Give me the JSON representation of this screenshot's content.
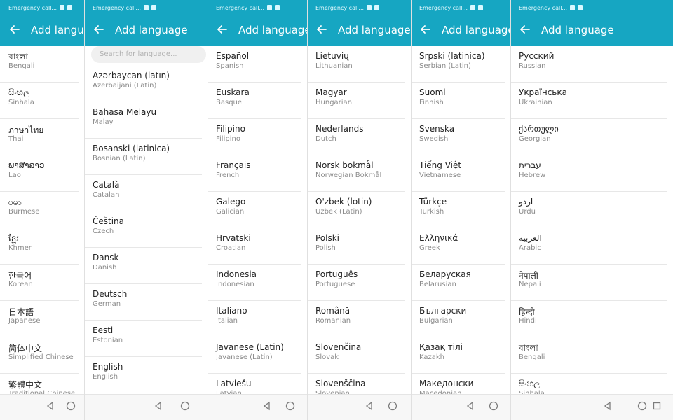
{
  "app_bar": {
    "title": "Add language",
    "status_text": "Emergency call..."
  },
  "search": {
    "placeholder": "Search for language..."
  },
  "panels": [
    {
      "items": [
        {
          "name": "বাংলা",
          "sub": "Bengali"
        },
        {
          "name": "සිංහල",
          "sub": "Sinhala"
        },
        {
          "name": "ภาษาไทย",
          "sub": "Thai"
        },
        {
          "name": "ພາສາລາວ",
          "sub": "Lao"
        },
        {
          "name": "ဗမာ",
          "sub": "Burmese"
        },
        {
          "name": "ខ្មែរ",
          "sub": "Khmer"
        },
        {
          "name": "한국어",
          "sub": "Korean"
        },
        {
          "name": "日本語",
          "sub": "Japanese"
        },
        {
          "name": "简体中文",
          "sub": "Simplified Chinese"
        },
        {
          "name": "繁體中文",
          "sub": "Traditional Chinese"
        }
      ]
    },
    {
      "items": [
        {
          "name": "Azərbaycan (latın)",
          "sub": "Azerbaijani (Latin)"
        },
        {
          "name": "Bahasa Melayu",
          "sub": "Malay"
        },
        {
          "name": "Bosanski (latinica)",
          "sub": "Bosnian (Latin)"
        },
        {
          "name": "Català",
          "sub": "Catalan"
        },
        {
          "name": "Čeština",
          "sub": "Czech"
        },
        {
          "name": "Dansk",
          "sub": "Danish"
        },
        {
          "name": "Deutsch",
          "sub": "German"
        },
        {
          "name": "Eesti",
          "sub": "Estonian"
        },
        {
          "name": "English",
          "sub": "English"
        }
      ]
    },
    {
      "items": [
        {
          "name": "Español",
          "sub": "Spanish"
        },
        {
          "name": "Euskara",
          "sub": "Basque"
        },
        {
          "name": "Filipino",
          "sub": "Filipino"
        },
        {
          "name": "Français",
          "sub": "French"
        },
        {
          "name": "Galego",
          "sub": "Galician"
        },
        {
          "name": "Hrvatski",
          "sub": "Croatian"
        },
        {
          "name": "Indonesia",
          "sub": "Indonesian"
        },
        {
          "name": "Italiano",
          "sub": "Italian"
        },
        {
          "name": "Javanese (Latin)",
          "sub": "Javanese (Latin)"
        },
        {
          "name": "Latviešu",
          "sub": "Latvian"
        }
      ]
    },
    {
      "items": [
        {
          "name": "Lietuvių",
          "sub": "Lithuanian"
        },
        {
          "name": "Magyar",
          "sub": "Hungarian"
        },
        {
          "name": "Nederlands",
          "sub": "Dutch"
        },
        {
          "name": "Norsk bokmål",
          "sub": "Norwegian Bokmål"
        },
        {
          "name": "O'zbek (lotin)",
          "sub": "Uzbek (Latin)"
        },
        {
          "name": "Polski",
          "sub": "Polish"
        },
        {
          "name": "Português",
          "sub": "Portuguese"
        },
        {
          "name": "Română",
          "sub": "Romanian"
        },
        {
          "name": "Slovenčina",
          "sub": "Slovak"
        },
        {
          "name": "Slovenščina",
          "sub": "Slovenian"
        }
      ]
    },
    {
      "items": [
        {
          "name": "Srpski (latinica)",
          "sub": "Serbian (Latin)"
        },
        {
          "name": "Suomi",
          "sub": "Finnish"
        },
        {
          "name": "Svenska",
          "sub": "Swedish"
        },
        {
          "name": "Tiếng Việt",
          "sub": "Vietnamese"
        },
        {
          "name": "Türkçe",
          "sub": "Turkish"
        },
        {
          "name": "Ελληνικά",
          "sub": "Greek"
        },
        {
          "name": "Беларуская",
          "sub": "Belarusian"
        },
        {
          "name": "Български",
          "sub": "Bulgarian"
        },
        {
          "name": "Қазақ тілі",
          "sub": "Kazakh"
        },
        {
          "name": "Македонски",
          "sub": "Macedonian"
        }
      ]
    },
    {
      "items": [
        {
          "name": "Русский",
          "sub": "Russian"
        },
        {
          "name": "Українська",
          "sub": "Ukrainian"
        },
        {
          "name": "ქართული",
          "sub": "Georgian"
        },
        {
          "name": "עברית",
          "sub": "Hebrew"
        },
        {
          "name": "اردو",
          "sub": "Urdu"
        },
        {
          "name": "العربية",
          "sub": "Arabic"
        },
        {
          "name": "नेपाली",
          "sub": "Nepali"
        },
        {
          "name": "हिन्दी",
          "sub": "Hindi"
        },
        {
          "name": "বাংলা",
          "sub": "Bengali"
        },
        {
          "name": "සිංහල",
          "sub": "Sinhala"
        }
      ]
    }
  ],
  "colors": {
    "accent": "#16a6c2",
    "divider": "#e7e7e7"
  },
  "icons": [
    "back-arrow-icon",
    "back-nav-icon",
    "home-nav-icon",
    "recents-nav-icon",
    "sim-status-icon",
    "wifi-status-icon"
  ]
}
